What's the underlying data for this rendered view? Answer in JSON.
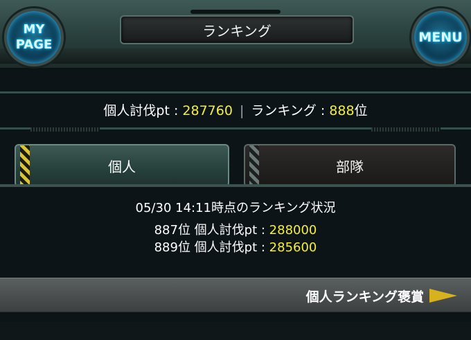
{
  "header": {
    "title": "ランキング",
    "mypage_line1": "MY",
    "mypage_line2": "PAGE",
    "menu_label": "MENU"
  },
  "status": {
    "points_label": "個人討伐pt : ",
    "points_value": "287760",
    "separator": "|",
    "rank_label": "ランキング : ",
    "rank_value": "888",
    "rank_suffix": "位"
  },
  "tabs": [
    {
      "label": "個人",
      "active": true
    },
    {
      "label": "部隊",
      "active": false
    }
  ],
  "ranking": {
    "timestamp_line": "05/30 14:11時点のランキング状況",
    "neighbors": [
      {
        "rank_text": "887位 個人討伐pt : ",
        "points": "288000"
      },
      {
        "rank_text": "889位 個人討伐pt : ",
        "points": "285600"
      }
    ]
  },
  "reward_banner": {
    "label": "個人ランキング褒賞"
  },
  "colors": {
    "highlight": "#f4ef3a",
    "accent_arrow": "#d8b21c"
  }
}
